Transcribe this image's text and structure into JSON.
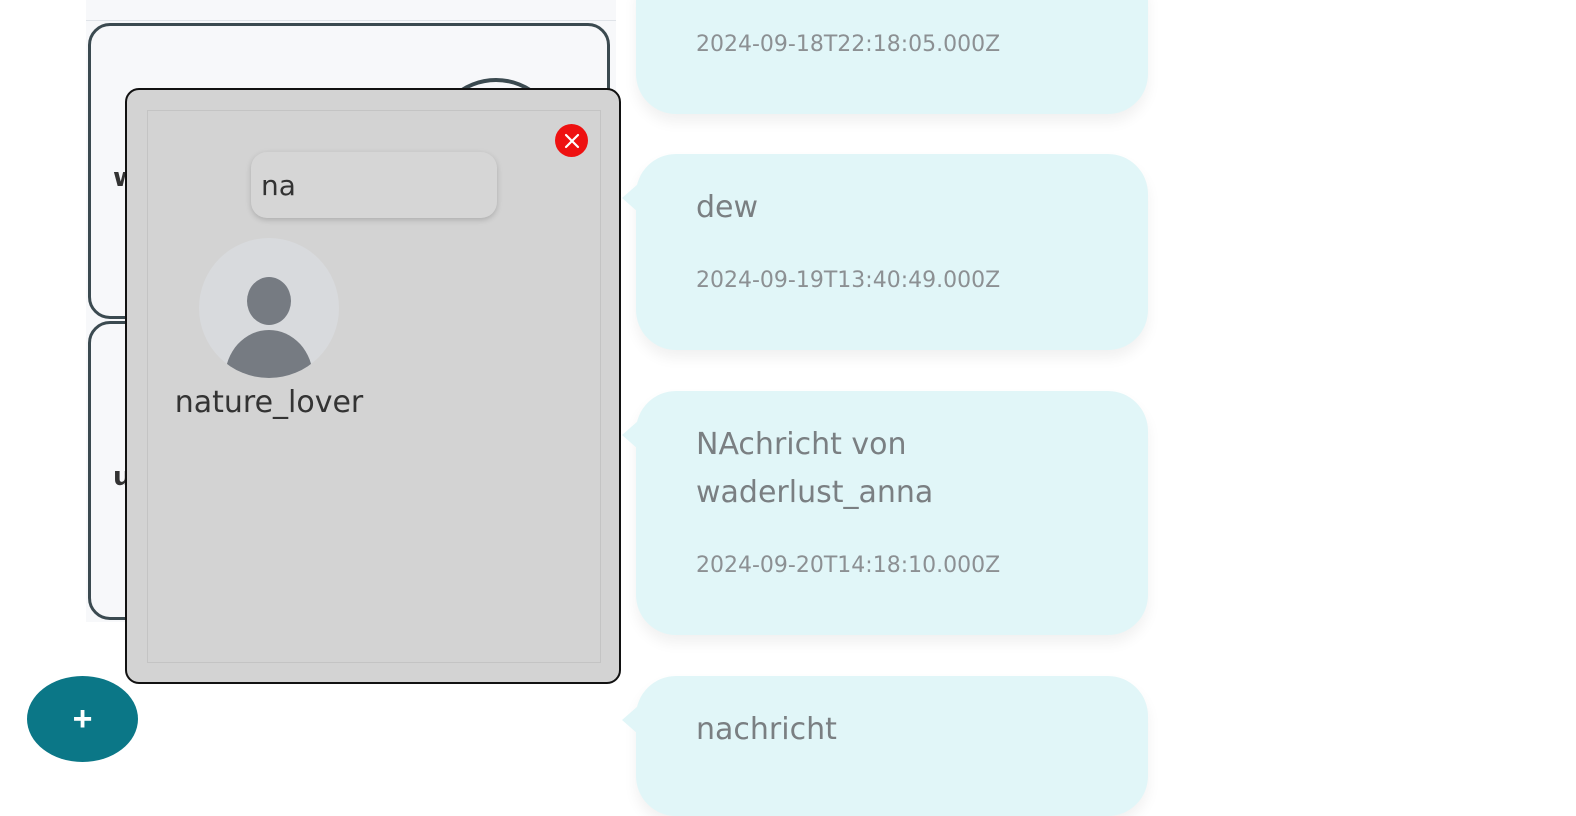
{
  "conversations": [
    {
      "initial": "w"
    },
    {
      "initial": "u"
    }
  ],
  "messages": [
    {
      "text": "",
      "timestamp": "2024-09-18T22:18:05.000Z"
    },
    {
      "text": "dew",
      "timestamp": "2024-09-19T13:40:49.000Z"
    },
    {
      "text": "NAchricht von waderlust_anna",
      "timestamp": "2024-09-20T14:18:10.000Z"
    },
    {
      "text": "nachricht",
      "timestamp": ""
    }
  ],
  "fab": {
    "label": "+"
  },
  "modal": {
    "search": {
      "value": "na",
      "placeholder": ""
    },
    "results": [
      {
        "username": "nature_lover"
      }
    ]
  },
  "colors": {
    "accent": "#0b7787",
    "bubble": "#e1f6f8",
    "close": "#e11111",
    "modal_bg": "#d3d3d3"
  },
  "icons": {
    "close": "close-icon",
    "avatar": "avatar-icon",
    "add": "plus-icon"
  }
}
